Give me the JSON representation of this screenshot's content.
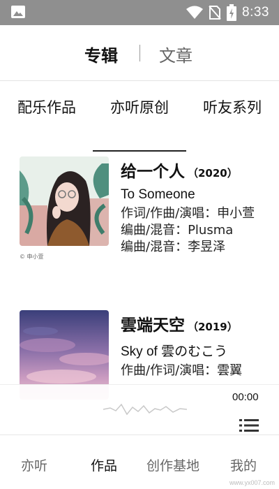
{
  "status_bar": {
    "time": "8:33",
    "icons": [
      "image-icon",
      "wifi-icon",
      "no-sim-icon",
      "battery-charging-icon"
    ],
    "background": "#8f8f8f"
  },
  "header": {
    "tabs": [
      {
        "label": "专辑",
        "active": true
      },
      {
        "label": "文章",
        "active": false
      }
    ]
  },
  "categories": {
    "tabs": [
      {
        "label": "配乐作品",
        "active": false
      },
      {
        "label": "亦听原创",
        "active": true
      },
      {
        "label": "听友系列",
        "active": false
      }
    ]
  },
  "albums": [
    {
      "title": "给一个人",
      "year": "（2020）",
      "subtitle": "To Someone",
      "cover_mark": "© 申小萱",
      "credits": [
        "作词/作曲/演唱：申小萱",
        "编曲/混音：Plusma",
        "编曲/混音：李昱泽"
      ]
    },
    {
      "title": "雲端天空",
      "year": "（2019）",
      "subtitle": "Sky of 雲のむこう",
      "credits": [
        "作曲/作词/演唱：雲翼"
      ]
    }
  ],
  "player": {
    "time": "00:00"
  },
  "bottom_nav": {
    "items": [
      {
        "label": "亦听",
        "active": false
      },
      {
        "label": "作品",
        "active": true
      },
      {
        "label": "创作基地",
        "active": false
      },
      {
        "label": "我的",
        "active": false
      }
    ]
  },
  "watermark": "www.yx007.com",
  "colors": {
    "accent": "#111111",
    "inactive": "#666666"
  }
}
